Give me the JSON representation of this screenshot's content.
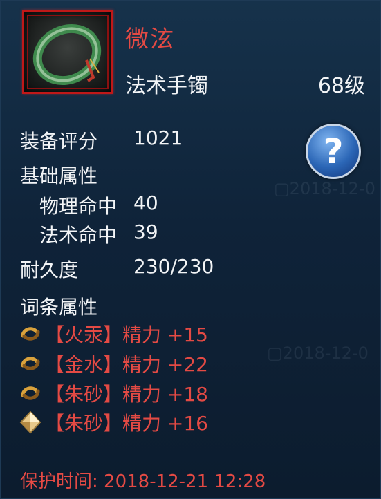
{
  "item": {
    "name": "微泫",
    "type": "法术手镯",
    "level": "68级"
  },
  "stats": {
    "score_label": "装备评分",
    "score_value": "1021",
    "base_header": "基础属性",
    "phys_label": "物理命中",
    "phys_value": "40",
    "magic_label": "法术命中",
    "magic_value": "39",
    "durability_label": "耐久度",
    "durability_value": "230/230",
    "affix_header": "词条属性"
  },
  "affixes": [
    {
      "icon": "swirl-icon",
      "text": "【火汞】精力 +15"
    },
    {
      "icon": "swirl-icon",
      "text": "【金水】精力 +22"
    },
    {
      "icon": "swirl-icon",
      "text": "【朱砂】精力 +18"
    },
    {
      "icon": "diamond-icon",
      "text": "【朱砂】精力 +16"
    }
  ],
  "help": {
    "symbol": "?"
  },
  "protect": {
    "text": "保护时间: 2018-12-21 12:28"
  },
  "colors": {
    "name_red": "#e44a44",
    "text_white": "#f2f4f6",
    "frame_red": "#c01818",
    "help_blue": "#2b66b6"
  }
}
